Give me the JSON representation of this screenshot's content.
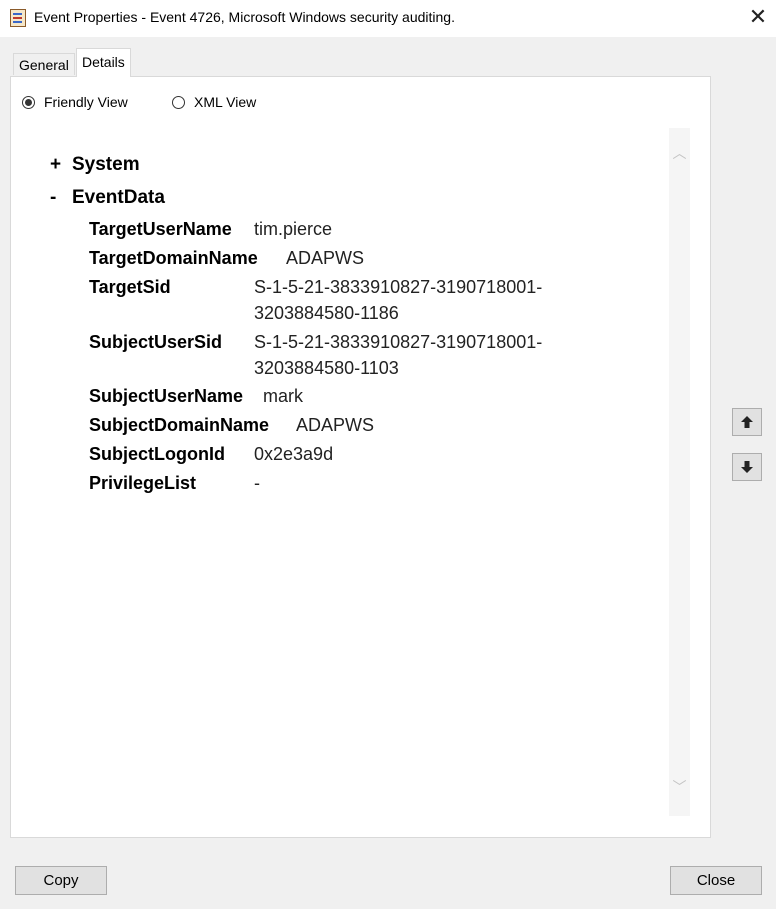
{
  "window": {
    "title": "Event Properties - Event 4726, Microsoft Windows security auditing.",
    "close_glyph": "✕"
  },
  "tabs": [
    {
      "label": "General",
      "selected": false
    },
    {
      "label": "Details",
      "selected": true
    }
  ],
  "view_options": {
    "friendly": {
      "label": "Friendly View",
      "selected": true
    },
    "xml": {
      "label": "XML View",
      "selected": false
    }
  },
  "tree": {
    "system": {
      "sign": "+",
      "label": "System"
    },
    "eventdata": {
      "sign": "-",
      "label": "EventData"
    },
    "fields": [
      {
        "key": "TargetUserName",
        "value": "tim.pierce"
      },
      {
        "key": "TargetDomainName",
        "value": "ADAPWS"
      },
      {
        "key": "TargetSid",
        "value_line1": "S-1-5-21-3833910827-3190718001-",
        "value_line2": "3203884580-1186"
      },
      {
        "key": "SubjectUserSid",
        "value_line1": "S-1-5-21-3833910827-3190718001-",
        "value_line2": "3203884580-1103"
      },
      {
        "key": "SubjectUserName",
        "value": "mark"
      },
      {
        "key": "SubjectDomainName",
        "value": "ADAPWS"
      },
      {
        "key": "SubjectLogonId",
        "value": "0x2e3a9d"
      },
      {
        "key": "PrivilegeList",
        "value": "-"
      }
    ]
  },
  "scrollbar": {
    "up_glyph": "︿",
    "down_glyph": "﹀"
  },
  "side_buttons": {
    "up_icon": "arrow-up-icon",
    "down_icon": "arrow-down-icon"
  },
  "buttons": {
    "copy": "Copy",
    "close": "Close"
  }
}
